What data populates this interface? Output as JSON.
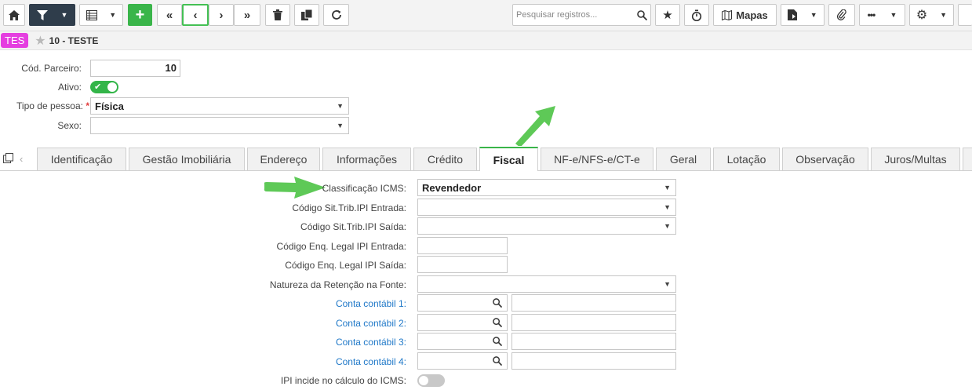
{
  "toolbar": {
    "search_placeholder": "Pesquisar registros...",
    "maps_label": "Mapas"
  },
  "record": {
    "badge": "TES",
    "title": "10 - TESTE"
  },
  "header": {
    "cod_parceiro_label": "Cód. Parceiro:",
    "cod_parceiro_value": "10",
    "ativo_label": "Ativo:",
    "ativo_on": true,
    "tipo_pessoa_label": "Tipo de pessoa:",
    "tipo_pessoa_required": "*",
    "tipo_pessoa_value": "Física",
    "sexo_label": "Sexo:",
    "sexo_value": ""
  },
  "tabs": [
    {
      "label": "Identificação"
    },
    {
      "label": "Gestão Imobiliária"
    },
    {
      "label": "Endereço"
    },
    {
      "label": "Informações"
    },
    {
      "label": "Crédito"
    },
    {
      "label": "Fiscal"
    },
    {
      "label": "NF-e/NFS-e/CT-e"
    },
    {
      "label": "Geral"
    },
    {
      "label": "Lotação"
    },
    {
      "label": "Observação"
    },
    {
      "label": "Juros/Multas"
    }
  ],
  "active_tab": "Fiscal",
  "fiscal": {
    "classificacao_label": "Classificação ICMS:",
    "classificacao_value": "Revendedor",
    "ipi_entrada_label": "Código Sit.Trib.IPI Entrada:",
    "ipi_saida_label": "Código Sit.Trib.IPI Saída:",
    "enq_entrada_label": "Código Enq. Legal IPI Entrada:",
    "enq_saida_label": "Código Enq. Legal IPI Saída:",
    "natureza_label": "Natureza da Retenção na Fonte:",
    "conta1_label": "Conta contábil 1:",
    "conta2_label": "Conta contábil 2:",
    "conta3_label": "Conta contábil 3:",
    "conta4_label": "Conta contábil 4:",
    "ipi_icms_label": "IPI incide no cálculo do ICMS:",
    "ipi_icms_on": false
  },
  "colors": {
    "accent_green": "#3ab54a",
    "toolbar_dark": "#2f3d4b",
    "badge_magenta": "#e53ee0",
    "link_blue": "#1f78c8",
    "annotation_arrow": "#5ec957"
  },
  "icons": [
    "home-icon",
    "filter-icon",
    "grid-icon",
    "plus-icon",
    "first-icon",
    "prev-icon",
    "next-icon",
    "last-icon",
    "trash-icon",
    "copy-icon",
    "refresh-icon",
    "search-icon",
    "star-icon",
    "timer-icon",
    "map-icon",
    "export-icon",
    "attach-icon",
    "more-icon",
    "gear-icon"
  ]
}
